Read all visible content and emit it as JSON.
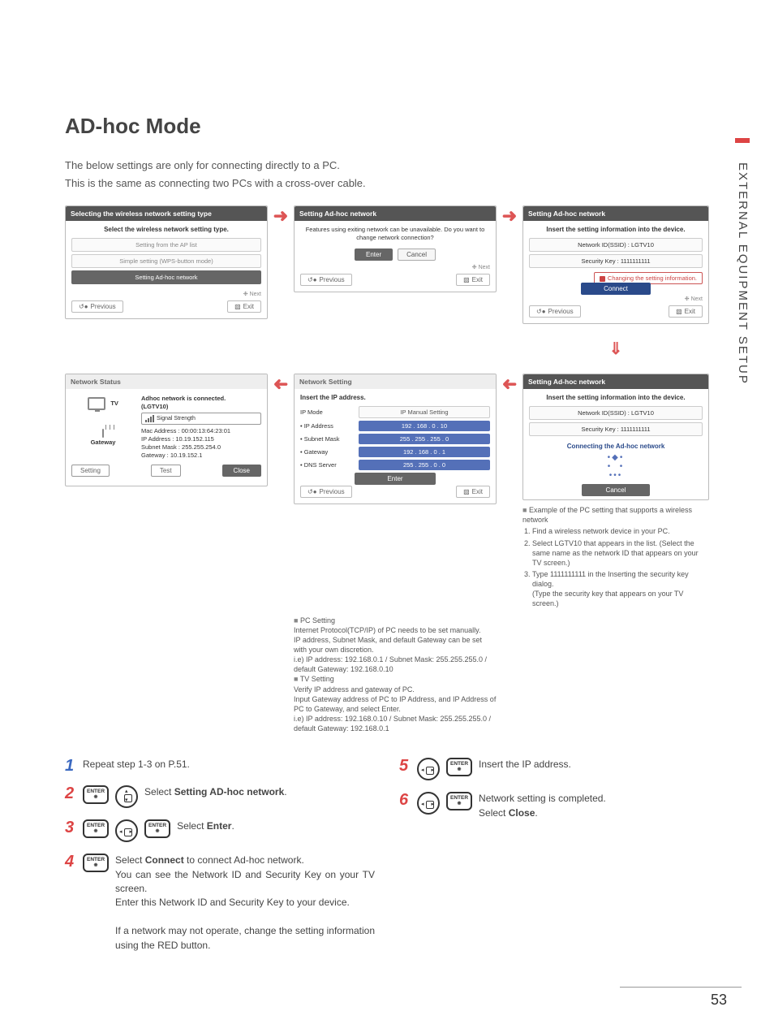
{
  "page": {
    "title": "AD-hoc Mode",
    "intro1": "The below settings are only for connecting directly to a PC.",
    "intro2": "This is the same as connecting two PCs with a cross-over cable.",
    "side_title": "EXTERNAL EQUIPMENT SETUP",
    "page_number": "53"
  },
  "panel_select": {
    "title": "Selecting the wireless network setting type",
    "subtitle": "Select the wireless network setting type.",
    "options": [
      "Setting from the AP list",
      "Simple setting (WPS-button mode)",
      "Setting Ad-hoc network"
    ],
    "selected_index": 2,
    "next": "Next",
    "prev": "Previous",
    "exit": "Exit"
  },
  "panel_confirm": {
    "title": "Setting Ad-hoc network",
    "text": "Features using exiting network can be unavailable. Do you want to change network connection?",
    "enter": "Enter",
    "cancel": "Cancel",
    "next": "Next",
    "prev1": "Previous",
    "exit1": "Exit"
  },
  "panel_info1": {
    "title": "Setting Ad-hoc network",
    "subtitle": "Insert the setting information into the device.",
    "ssid_label": "Network ID(SSID) : LGTV10",
    "key_label": "Security Key : 1111111111",
    "change_btn": "Changing the setting information.",
    "connect": "Connect",
    "next": "Next",
    "prev": "Previous",
    "exit": "Exit"
  },
  "panel_info2": {
    "title": "Setting Ad-hoc network",
    "subtitle": "Insert the setting information into the device.",
    "ssid_label": "Network ID(SSID) : LGTV10",
    "key_label": "Security Key : 1111111111",
    "connecting": "Connecting the Ad-hoc network",
    "cancel": "Cancel"
  },
  "panel_netset": {
    "title": "Network Setting",
    "subtitle": "Insert the IP address.",
    "rows": [
      {
        "label": "IP Mode",
        "value": "IP Manual Setting",
        "plain": true
      },
      {
        "label": "• IP Address",
        "value": "192 . 168 . 0 . 10"
      },
      {
        "label": "• Subnet Mask",
        "value": "255 . 255 . 255 . 0"
      },
      {
        "label": "• Gateway",
        "value": "192 . 168 . 0 . 1"
      },
      {
        "label": "• DNS Server",
        "value": "255 . 255 . 0 . 0"
      }
    ],
    "enter": "Enter",
    "prev": "Previous",
    "exit": "Exit"
  },
  "panel_status": {
    "title": "Network Status",
    "connected": "Adhoc network is connected.",
    "ssid": "(LGTV10)",
    "signal_label": "Signal Strength",
    "mac": "Mac Address : 00:00:13:64:23:01",
    "ip": "IP Address    : 10.19.152.115",
    "subnet": "Subnet Mask : 255.255.254.0",
    "gateway": "Gateway       : 10.19.152.1",
    "tv_label": "TV",
    "gw_label": "Gateway",
    "setting": "Setting",
    "test": "Test",
    "close": "Close"
  },
  "notes_pc": {
    "heading": "PC Setting",
    "l1": "Internet Protocol(TCP/IP) of PC needs to be set manually.",
    "l2": "IP address, Subnet Mask, and default Gateway can be set with your own discretion.",
    "l3": "i.e) IP address: 192.168.0.1 / Subnet Mask: 255.255.255.0 / default Gateway: 192.168.0.10",
    "tv_heading": "TV Setting",
    "l4": "Verify IP address and gateway of PC.",
    "l5": "Input Gateway address of PC to IP Address, and IP Address of PC to Gateway, and select Enter.",
    "l6": "i.e) IP address: 192.168.0.10 / Subnet Mask: 255.255.255.0 / default Gateway: 192.168.0.1"
  },
  "notes_example": {
    "heading": "Example of the PC setting that supports a wireless network",
    "items": [
      "Find a wireless network device in your PC.",
      "Select LGTV10 that appears in the list. (Select the same name as the network ID that appears on your TV screen.)",
      "Type 1111111111 in the Inserting the security key dialog."
    ],
    "tail": "(Type the security key that appears on your TV screen.)"
  },
  "steps": {
    "s1": "Repeat step 1-3 on P.51.",
    "s2a": "Select ",
    "s2b": "Setting AD-hoc network",
    "s2c": ".",
    "s3a": "Select ",
    "s3b": "Enter",
    "s3c": ".",
    "s4a": "Select ",
    "s4b": "Connect",
    "s4c": " to connect Ad-hoc network.",
    "s4d": "You can see the Network ID and Security Key on your TV screen.",
    "s4e": "Enter this Network ID and Security Key to your device.",
    "s4f": "If a network may not operate, change the setting information using the RED button.",
    "s5": "Insert the IP address.",
    "s6a": "Network setting is completed.",
    "s6b": "Select ",
    "s6c": "Close",
    "s6d": ".",
    "enter_btn": "ENTER"
  }
}
